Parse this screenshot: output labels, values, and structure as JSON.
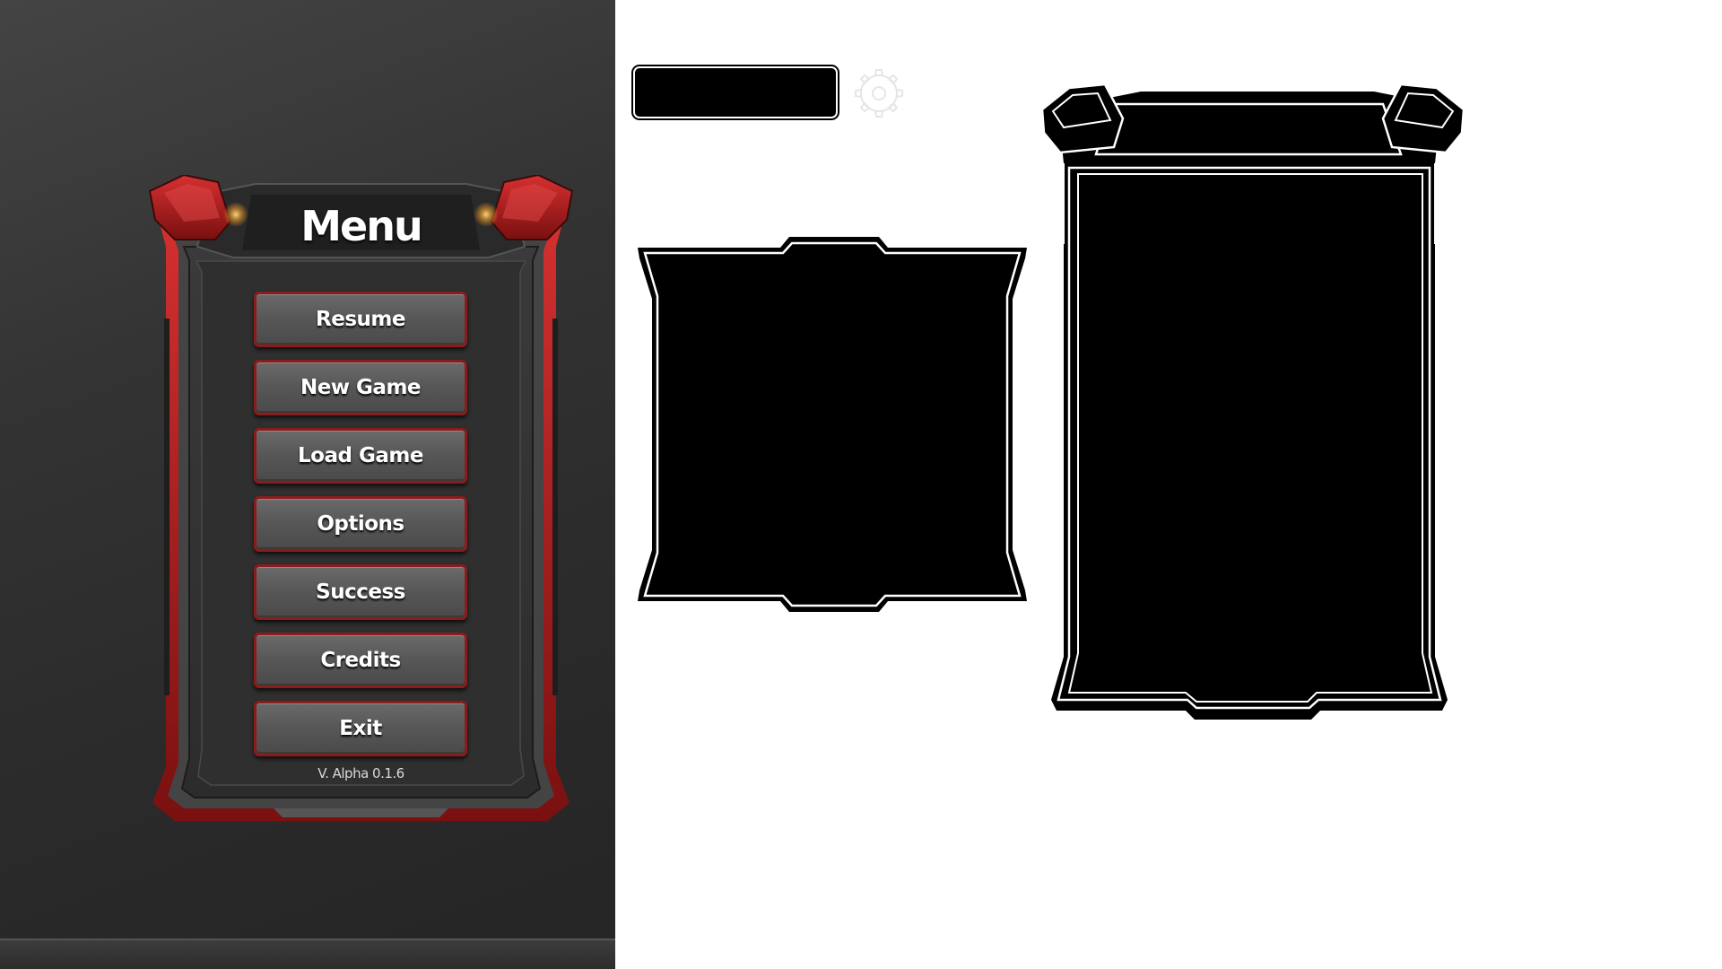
{
  "menu": {
    "title": "Menu",
    "buttons": [
      {
        "label": "Resume"
      },
      {
        "label": "New Game"
      },
      {
        "label": "Load Game"
      },
      {
        "label": "Options"
      },
      {
        "label": "Success"
      },
      {
        "label": "Credits"
      },
      {
        "label": "Exit"
      }
    ],
    "version": "V. Alpha 0.1.6"
  },
  "icons": {
    "gear": "gear-icon"
  },
  "colors": {
    "accent_red": "#b51f1f",
    "panel_dark": "#2e2e2e",
    "button_gray": "#5a5a5a",
    "mask_black": "#000000",
    "background_white": "#ffffff"
  }
}
